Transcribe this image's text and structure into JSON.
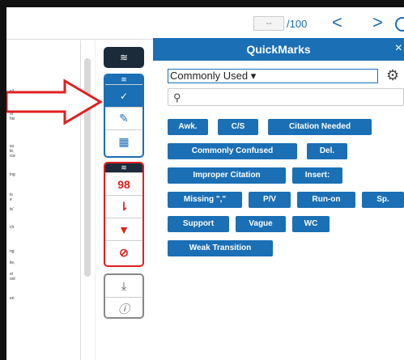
{
  "toolbar": {
    "page_input_placeholder": "--",
    "page_total": "/100",
    "prev_glyph": "<",
    "next_glyph": ">"
  },
  "document": {
    "lines": [
      "n't",
      "of",
      "his",
      "so",
      "le,",
      "rce",
      "ing",
      "ts",
      "e",
      "ts'",
      "ch",
      "ng",
      "ile,",
      "st",
      "ool",
      "en"
    ]
  },
  "tool_strip": {
    "groups": [
      {
        "name": "layers",
        "icons": [
          "layers-icon"
        ]
      },
      {
        "name": "grading",
        "icons": [
          "layers-icon",
          "check-icon",
          "edit-icon",
          "grid-icon"
        ]
      },
      {
        "name": "similarity",
        "icons": [
          "layers-icon",
          "similarity-score",
          "sort-icon",
          "filter-icon",
          "exclude-icon"
        ],
        "similarity_score": "98"
      },
      {
        "name": "misc",
        "icons": [
          "download-icon",
          "info-icon"
        ]
      }
    ]
  },
  "quickmarks": {
    "title": "QuickMarks",
    "close_glyph": "×",
    "set_name": "Commonly Used",
    "search_placeholder": "",
    "marks": [
      "Awk.",
      "C/S",
      "Citation Needed",
      "Commonly Confused",
      "Del.",
      "Improper Citation",
      "Insert:",
      "Missing \",\"",
      "P/V",
      "Run-on",
      "Sp.",
      "Support",
      "Vague",
      "WC",
      "Weak Transition"
    ]
  },
  "colors": {
    "accent": "#1a6fb5",
    "dark": "#1c2b3a",
    "alert": "#e02020"
  }
}
